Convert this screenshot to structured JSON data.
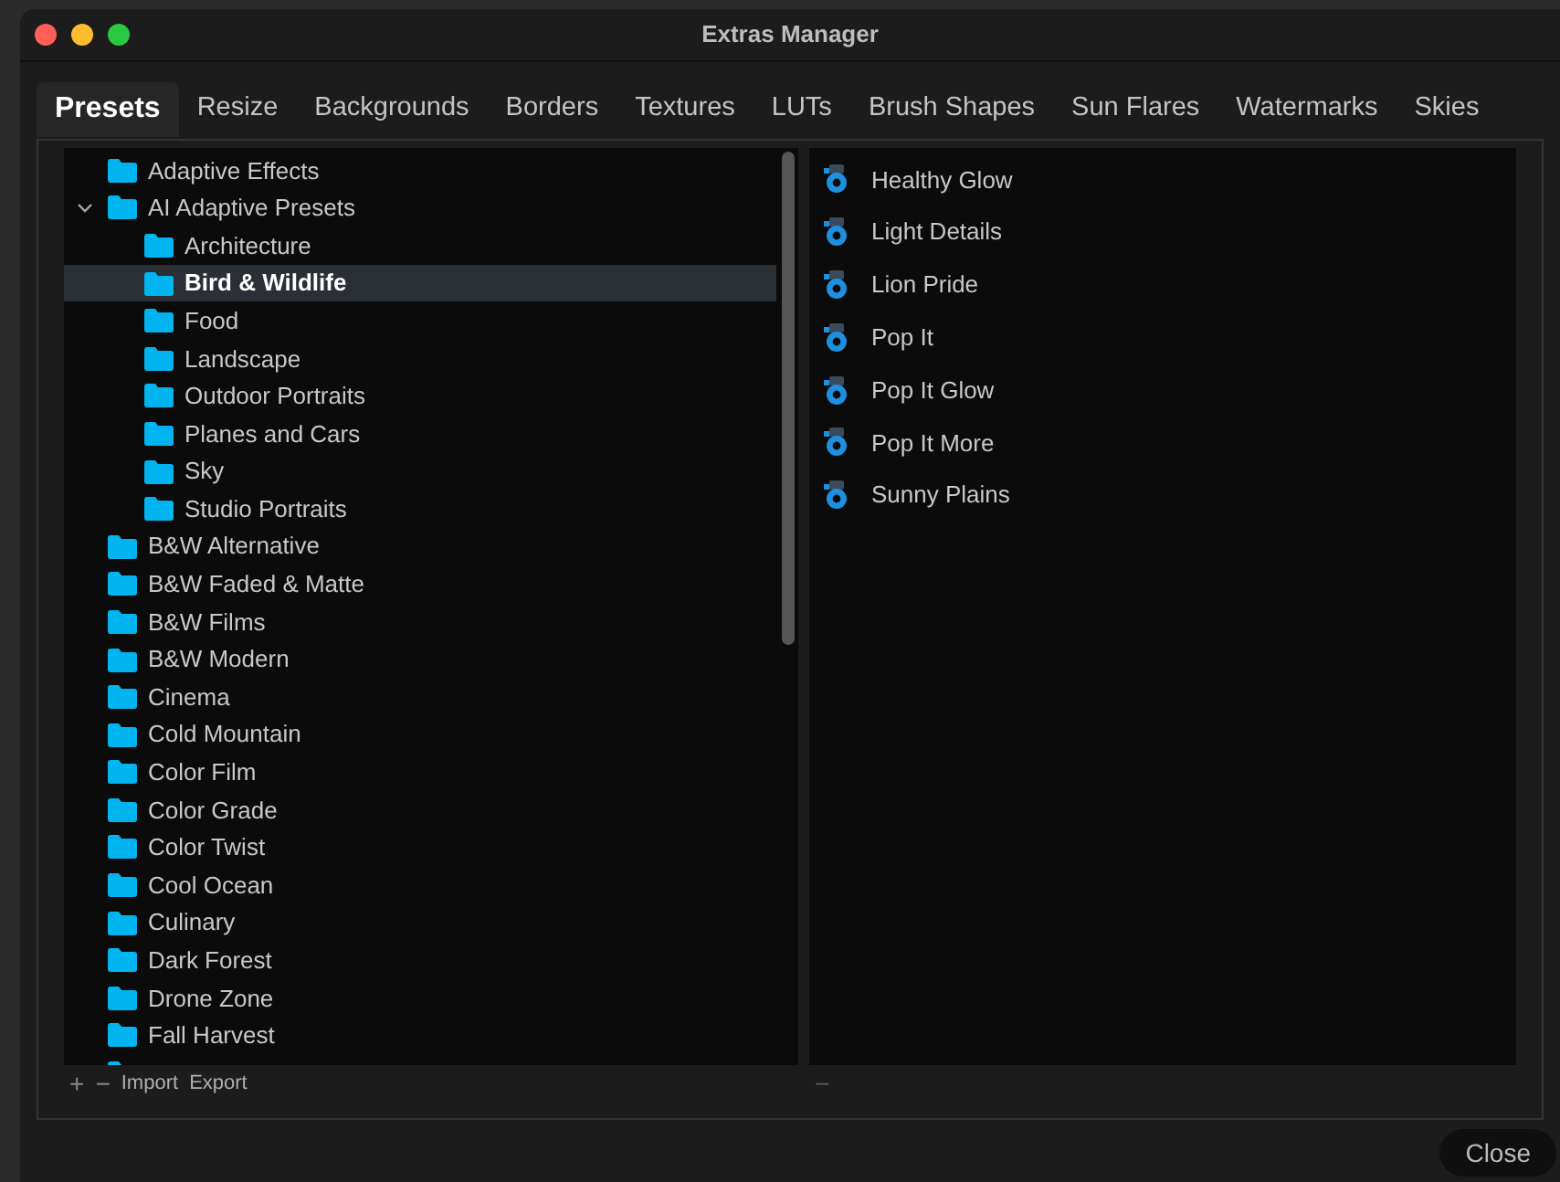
{
  "window": {
    "title": "Extras Manager"
  },
  "tabs": [
    {
      "label": "Presets",
      "selected": true
    },
    {
      "label": "Resize",
      "selected": false
    },
    {
      "label": "Backgrounds",
      "selected": false
    },
    {
      "label": "Borders",
      "selected": false
    },
    {
      "label": "Textures",
      "selected": false
    },
    {
      "label": "LUTs",
      "selected": false
    },
    {
      "label": "Brush Shapes",
      "selected": false
    },
    {
      "label": "Sun Flares",
      "selected": false
    },
    {
      "label": "Watermarks",
      "selected": false
    },
    {
      "label": "Skies",
      "selected": false
    }
  ],
  "folders": [
    {
      "label": "Adaptive Effects",
      "selected": false
    },
    {
      "label": "AI Adaptive Presets",
      "selected": false,
      "expanded": true,
      "children": [
        {
          "label": "Architecture",
          "selected": false
        },
        {
          "label": "Bird & Wildlife",
          "selected": true
        },
        {
          "label": "Food",
          "selected": false
        },
        {
          "label": "Landscape",
          "selected": false
        },
        {
          "label": "Outdoor Portraits",
          "selected": false
        },
        {
          "label": "Planes and Cars",
          "selected": false
        },
        {
          "label": "Sky",
          "selected": false
        },
        {
          "label": "Studio Portraits",
          "selected": false
        }
      ]
    },
    {
      "label": "B&W Alternative",
      "selected": false
    },
    {
      "label": "B&W Faded & Matte",
      "selected": false
    },
    {
      "label": "B&W Films",
      "selected": false
    },
    {
      "label": "B&W Modern",
      "selected": false
    },
    {
      "label": "Cinema",
      "selected": false
    },
    {
      "label": "Cold Mountain",
      "selected": false
    },
    {
      "label": "Color Film",
      "selected": false
    },
    {
      "label": "Color Grade",
      "selected": false
    },
    {
      "label": "Color Twist",
      "selected": false
    },
    {
      "label": "Cool Ocean",
      "selected": false
    },
    {
      "label": "Culinary",
      "selected": false
    },
    {
      "label": "Dark Forest",
      "selected": false
    },
    {
      "label": "Drone Zone",
      "selected": false
    },
    {
      "label": "Fall Harvest",
      "selected": false
    }
  ],
  "folder_footer": {
    "add": "+",
    "remove": "−",
    "import": "Import",
    "export": "Export"
  },
  "presets": [
    "Healthy Glow",
    "Light Details",
    "Lion Pride",
    "Pop It",
    "Pop It Glow",
    "Pop It More",
    "Sunny Plains"
  ],
  "preset_footer": {
    "remove": "−"
  },
  "close_button": "Close"
}
